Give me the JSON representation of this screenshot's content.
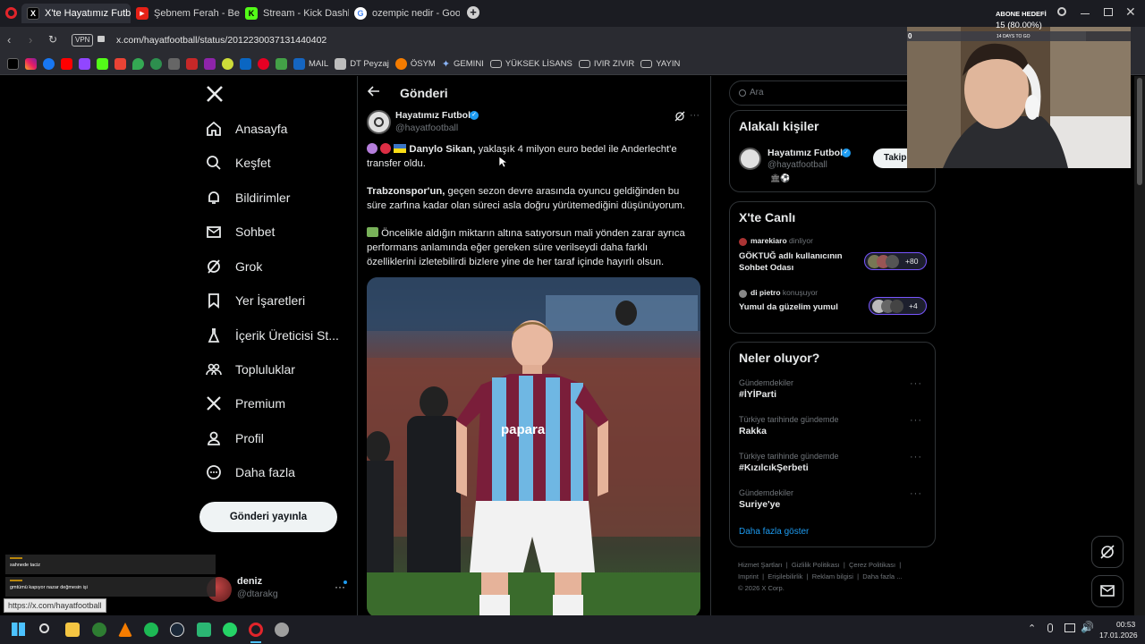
{
  "browser": {
    "tabs": [
      {
        "title": "X'te Hayatımız Futbol: \"",
        "active": true
      },
      {
        "title": "Şebnem Ferah - Ben Şarkı"
      },
      {
        "title": "Stream - Kick Dashboard"
      },
      {
        "title": "ozempic nedir - Google'd"
      }
    ],
    "url": "x.com/hayatfootball/status/2012230037131440402",
    "vpn_label": "VPN",
    "bookmarks": [
      "MAIL",
      "DT Peyzaj",
      "ÖSYM",
      "GEMINI",
      "YÜKSEK LİSANS",
      "IVIR ZIVIR",
      "YAYIN"
    ]
  },
  "overlay": {
    "subscriber_goal_title": "ABONE HEDEFİ",
    "subscriber_goal_value": "15 (80.00%)",
    "days_to_go": "14 DAYS TO GO",
    "counter": "0",
    "chat": [
      {
        "user": "",
        "message": "sahnede taciz"
      },
      {
        "user": "",
        "message": "gmtümü kapıyor nazar değmesin işi"
      }
    ],
    "status_url": "https://x.com/hayatfootball"
  },
  "sidebar": {
    "items": [
      {
        "label": "Anasayfa",
        "icon": "home-icon"
      },
      {
        "label": "Keşfet",
        "icon": "search-icon"
      },
      {
        "label": "Bildirimler",
        "icon": "bell-icon"
      },
      {
        "label": "Sohbet",
        "icon": "mail-icon"
      },
      {
        "label": "Grok",
        "icon": "grok-icon"
      },
      {
        "label": "Yer İşaretleri",
        "icon": "bookmark-icon"
      },
      {
        "label": "İçerik Üreticisi St...",
        "icon": "flask-icon"
      },
      {
        "label": "Topluluklar",
        "icon": "communities-icon"
      },
      {
        "label": "Premium",
        "icon": "x-logo-icon"
      },
      {
        "label": "Profil",
        "icon": "person-icon"
      },
      {
        "label": "Daha fazla",
        "icon": "more-circle-icon"
      }
    ],
    "post_button": "Gönderi yayınla",
    "account": {
      "name": "deniz",
      "handle": "@dtarakg"
    }
  },
  "main": {
    "header_title": "Gönderi",
    "post": {
      "author_name": "Hayatımız Futbol",
      "author_handle": "@hayatfootball",
      "p1_bold": "Danylo Sikan,",
      "p1_rest": " yaklaşık 4 milyon euro bedel ile Anderlecht'e transfer oldu.",
      "p2_bold": "Trabzonspor'un,",
      "p2_rest": " geçen sezon devre arasında oyuncu geldiğinden bu süre zarfına kadar olan süreci asla doğru yürütemediğini düşünüyorum.",
      "p3": "Öncelikle aldığın miktarın altına satıyorsun mali yönden zarar ayrıca performans anlamında eğer gereken süre verilseydi daha farklı özelliklerini izletebilirdi bizlere yine de her taraf içinde hayırlı olsun.",
      "jersey_text": "papara"
    }
  },
  "right": {
    "search_placeholder": "Ara",
    "related": {
      "title": "Alakalı kişiler",
      "name": "Hayatımız Futbol",
      "handle": "@hayatfootball",
      "follow_label": "Takip"
    },
    "live": {
      "title": "X'te Canlı",
      "spaces": [
        {
          "host": "marekiaro",
          "status": "dinliyor",
          "title": "GÖKTUĞ adlı kullanıcının Sohbet Odası",
          "count": "+80"
        },
        {
          "host": "di pietro",
          "status": "konuşuyor",
          "title": "Yumul da güzelim yumul",
          "count": "+4"
        }
      ]
    },
    "trends": {
      "title": "Neler oluyor?",
      "items": [
        {
          "context": "Gündemdekiler",
          "name": "#İYİParti"
        },
        {
          "context": "Türkiye tarihinde gündemde",
          "name": "Rakka"
        },
        {
          "context": "Türkiye tarihinde gündemde",
          "name": "#KızılcıkŞerbeti"
        },
        {
          "context": "Gündemdekiler",
          "name": "Suriye'ye"
        }
      ],
      "show_more": "Daha fazla göster"
    },
    "footer": {
      "links": [
        "Hizmet Şartları",
        "Gizlilik Politikası",
        "Çerez Politikası",
        "Imprint",
        "Erişilebilirlik",
        "Reklam bilgisi",
        "Daha fazla ..."
      ],
      "copyright": "© 2026 X Corp."
    }
  },
  "taskbar": {
    "time": "00:53",
    "date": "17.01.2026"
  },
  "colors": {
    "accent": "#1d9bf0",
    "border": "#2f3336",
    "muted": "#71767b"
  }
}
